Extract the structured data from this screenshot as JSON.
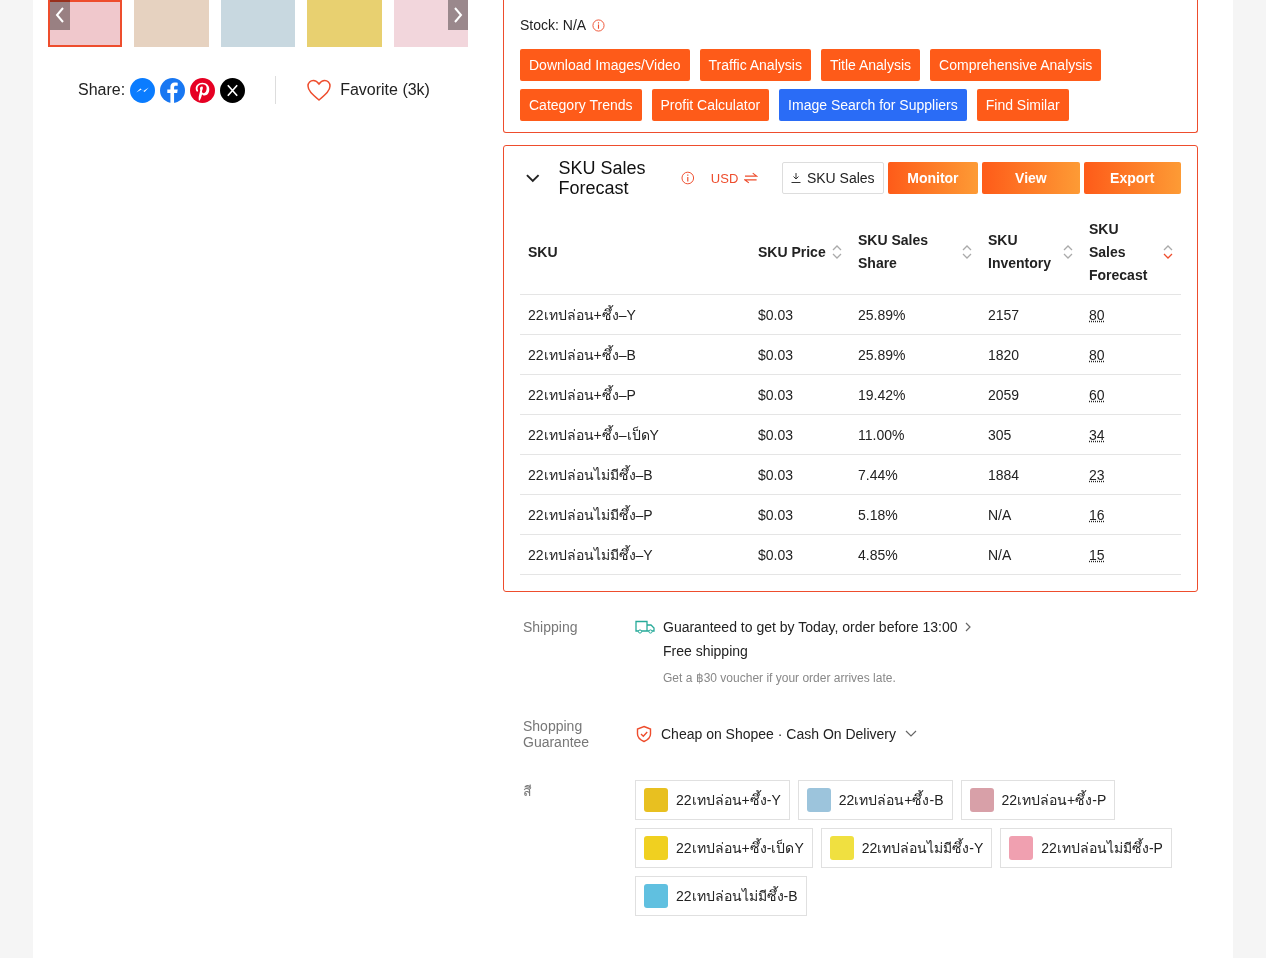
{
  "gallery": {
    "thumbnails": [
      {
        "selected": true
      },
      {
        "selected": false
      },
      {
        "selected": false
      },
      {
        "selected": false
      },
      {
        "selected": false
      }
    ]
  },
  "share": {
    "label": "Share:",
    "favorite": "Favorite (3k)"
  },
  "summary": {
    "stock": "Stock: N/A",
    "actions": [
      {
        "label": "Download Images/Video",
        "kind": "primary"
      },
      {
        "label": "Traffic Analysis",
        "kind": "primary"
      },
      {
        "label": "Title Analysis",
        "kind": "primary"
      },
      {
        "label": "Comprehensive Analysis",
        "kind": "primary"
      },
      {
        "label": "Category Trends",
        "kind": "primary"
      },
      {
        "label": "Profit Calculator",
        "kind": "primary"
      },
      {
        "label": "Image Search for Suppliers",
        "kind": "secondary"
      },
      {
        "label": "Find Similar",
        "kind": "primary"
      }
    ]
  },
  "forecast": {
    "title": "SKU Sales Forecast",
    "expanded": true,
    "currency": "USD",
    "download": "SKU Sales",
    "buttons": [
      "Monitor",
      "View",
      "Export"
    ],
    "columns": [
      {
        "label": "SKU",
        "sortable": false
      },
      {
        "label": "SKU Price",
        "sorted": false,
        "sortable": true
      },
      {
        "label": "SKU Sales Share",
        "sorted": false,
        "sortable": true
      },
      {
        "label": "SKU Inventory",
        "sorted": false,
        "sortable": true
      },
      {
        "label": "SKU Sales Forecast",
        "sorted": true,
        "sortable": true
      }
    ],
    "rows": [
      [
        "22เทปล่อน+ซึ้ง–Y",
        "$0.03",
        "25.89%",
        "2157",
        "80"
      ],
      [
        "22เทปล่อน+ซึ้ง–B",
        "$0.03",
        "25.89%",
        "1820",
        "80"
      ],
      [
        "22เทปล่อน+ซึ้ง–P",
        "$0.03",
        "19.42%",
        "2059",
        "60"
      ],
      [
        "22เทปล่อน+ซึ้ง–เป็ดY",
        "$0.03",
        "11.00%",
        "305",
        "34"
      ],
      [
        "22เทปล่อนไม่มีซึ้ง–B",
        "$0.03",
        "7.44%",
        "1884",
        "23"
      ],
      [
        "22เทปล่อนไม่มีซึ้ง–P",
        "$0.03",
        "5.18%",
        "N/A",
        "16"
      ],
      [
        "22เทปล่อนไม่มีซึ้ง–Y",
        "$0.03",
        "4.85%",
        "N/A",
        "15"
      ]
    ]
  },
  "shipping": {
    "label": "Shipping",
    "headline": "Guaranteed to get by Today, order before 13:00",
    "free": "Free shipping",
    "note": "Get a ฿30 voucher if your order arrives late."
  },
  "guarantee": {
    "label": "Shopping Guarantee",
    "text": "Cheap on Shopee · Cash On Delivery"
  },
  "variations": {
    "label": "สี",
    "options": [
      {
        "label": "22เทปล่อน+ซึ้ง-Y",
        "selected": false,
        "color": "#e8c020"
      },
      {
        "label": "22เทปล่อน+ซึ้ง-B",
        "selected": false,
        "color": "#9cc4dc"
      },
      {
        "label": "22เทปล่อน+ซึ้ง-P",
        "selected": false,
        "color": "#d8a0a8"
      },
      {
        "label": "22เทปล่อน+ซึ้ง-เป็ดY",
        "selected": false,
        "color": "#f0d020"
      },
      {
        "label": "22เทปล่อนไม่มีซึ้ง-Y",
        "selected": false,
        "color": "#f0e040"
      },
      {
        "label": "22เทปล่อนไม่มีซึ้ง-P",
        "selected": false,
        "color": "#f0a0b0"
      },
      {
        "label": "22เทปล่อนไม่มีซึ้ง-B",
        "selected": false,
        "color": "#60c0e0"
      }
    ]
  }
}
